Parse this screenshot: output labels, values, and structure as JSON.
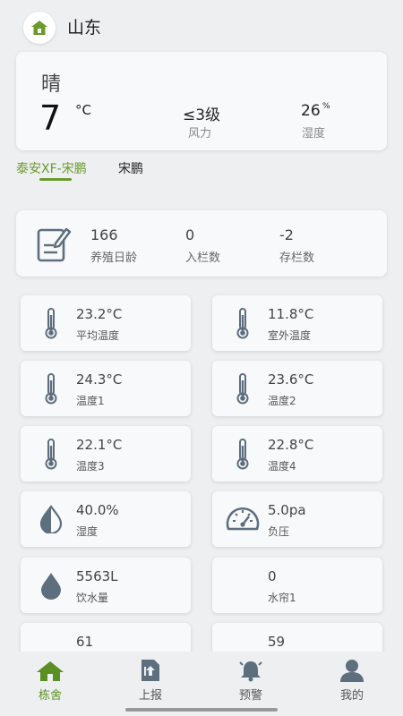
{
  "header": {
    "title": "山东",
    "icon": "home-icon"
  },
  "weather": {
    "condition": "晴",
    "temperature": "7",
    "temperature_unit": "°C",
    "wind_value": "≤3级",
    "wind_label": "风力",
    "humidity_value": "26",
    "humidity_unit": "%",
    "humidity_label": "湿度"
  },
  "tabs": [
    {
      "label": "泰安XF-宋鹏",
      "active": true
    },
    {
      "label": "宋鹏",
      "active": false
    }
  ],
  "stats": {
    "icon": "document-edit-icon",
    "items": [
      {
        "value": "166",
        "label": "养殖日龄"
      },
      {
        "value": "0",
        "label": "入栏数"
      },
      {
        "value": "-2",
        "label": "存栏数"
      }
    ]
  },
  "tiles": [
    {
      "value": "23.2°C",
      "label": "平均温度",
      "icon": "thermometer-icon"
    },
    {
      "value": "11.8°C",
      "label": "室外温度",
      "icon": "thermometer-icon"
    },
    {
      "value": "24.3°C",
      "label": "温度1",
      "icon": "thermometer-icon"
    },
    {
      "value": "23.6°C",
      "label": "温度2",
      "icon": "thermometer-icon"
    },
    {
      "value": "22.1°C",
      "label": "温度3",
      "icon": "thermometer-icon"
    },
    {
      "value": "22.8°C",
      "label": "温度4",
      "icon": "thermometer-icon"
    },
    {
      "value": "40.0%",
      "label": "湿度",
      "icon": "humidity-drop-icon"
    },
    {
      "value": "5.0pa",
      "label": "负压",
      "icon": "gauge-icon"
    },
    {
      "value": "5563L",
      "label": "饮水量",
      "icon": "water-drop-icon"
    },
    {
      "value": "0",
      "label": "水帘1",
      "icon": ""
    },
    {
      "value": "61",
      "label": "",
      "icon": ""
    },
    {
      "value": "59",
      "label": "",
      "icon": ""
    }
  ],
  "nav": [
    {
      "label": "栋舍",
      "icon": "home-icon",
      "active": true
    },
    {
      "label": "上报",
      "icon": "report-upload-icon",
      "active": false
    },
    {
      "label": "预警",
      "icon": "alarm-bell-icon",
      "active": false
    },
    {
      "label": "我的",
      "icon": "user-icon",
      "active": false
    }
  ],
  "colors": {
    "accent": "#6a9a2c",
    "icon": "#5d6e7e",
    "background": "#eeeff1",
    "card": "#f8f9fb"
  }
}
